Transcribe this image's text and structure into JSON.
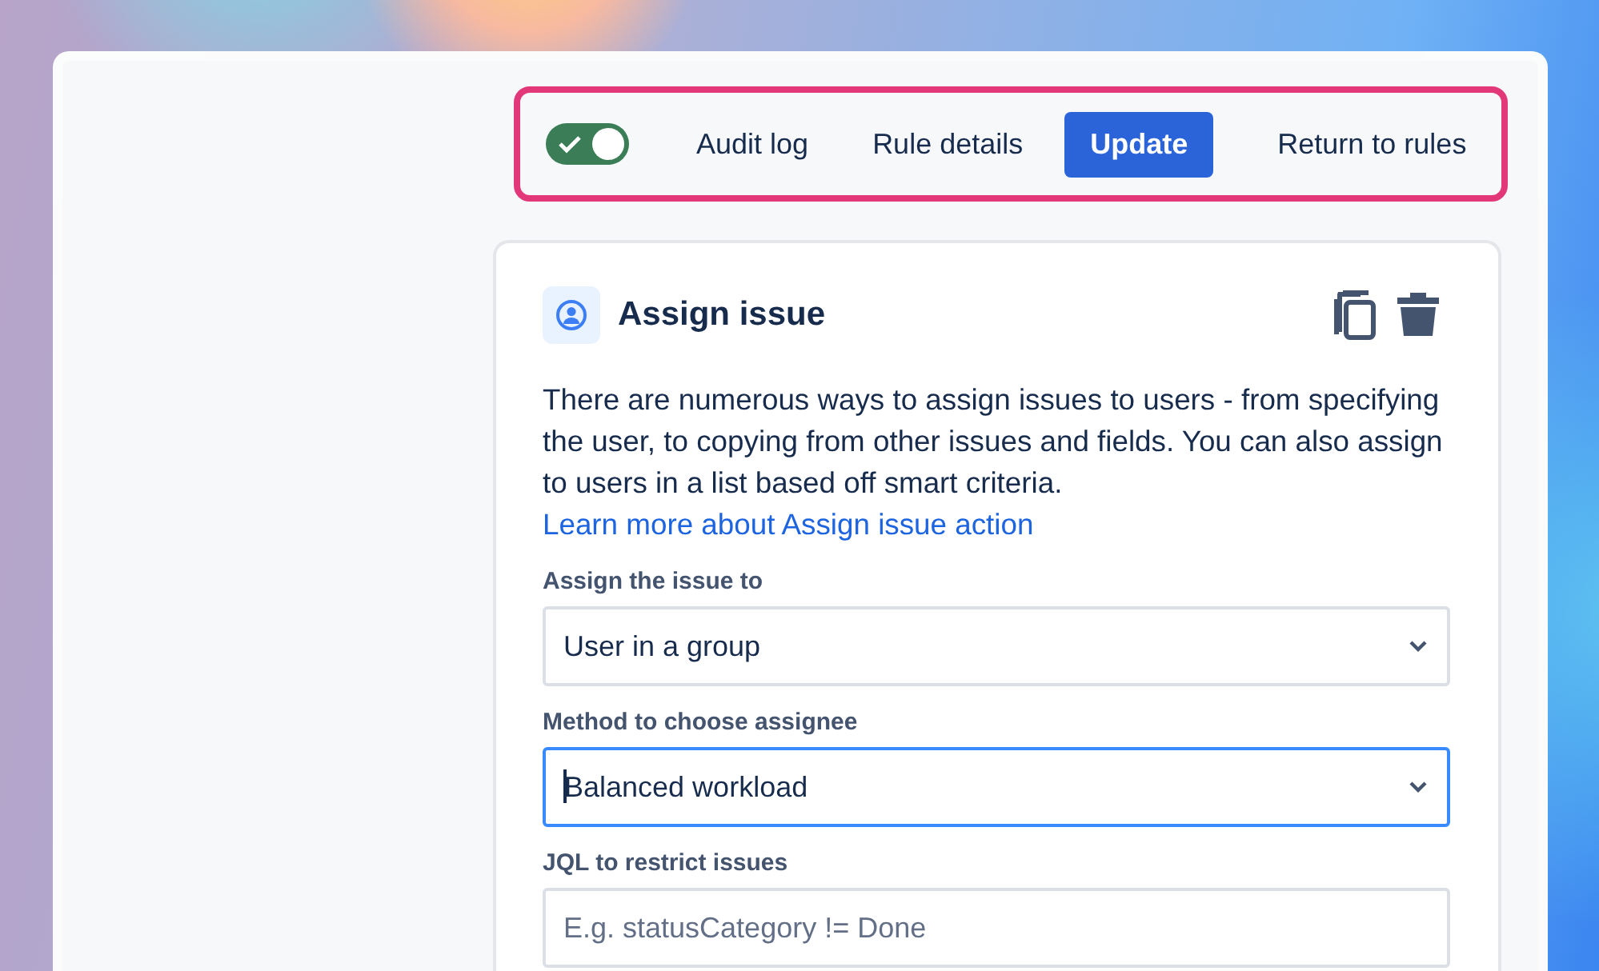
{
  "toolbar": {
    "highlighted": true,
    "toggle": {
      "on": true
    },
    "items": [
      {
        "kind": "link",
        "label": "Audit log"
      },
      {
        "kind": "link",
        "label": "Rule details"
      },
      {
        "kind": "primary",
        "label": "Update"
      },
      {
        "kind": "divider"
      },
      {
        "kind": "link",
        "label": "Return to rules"
      }
    ]
  },
  "card": {
    "title": "Assign issue",
    "description": "There are numerous ways to assign issues to users - from specifying the user, to copying from other issues and fields. You can also assign to users in a list based off smart criteria.",
    "link": "Learn more about Assign issue action",
    "fields": [
      {
        "kind": "select",
        "label": "Assign the issue to",
        "value": "User in a group",
        "focused": false
      },
      {
        "kind": "select",
        "label": "Method to choose assignee",
        "value": "Balanced workload",
        "focused": true
      },
      {
        "kind": "input",
        "label": "JQL to restrict issues",
        "placeholder": "E.g. statusCategory != Done",
        "focused": false
      }
    ]
  }
}
